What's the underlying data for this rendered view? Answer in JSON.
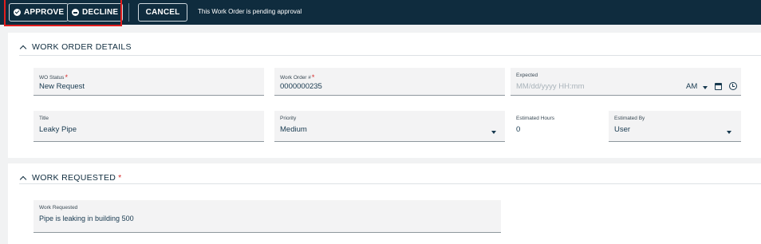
{
  "toolbar": {
    "approve_label": "APPROVE",
    "decline_label": "DECLINE",
    "cancel_label": "CANCEL",
    "status_message": "This Work Order is pending approval"
  },
  "details_section": {
    "title": "WORK ORDER DETAILS",
    "wo_status": {
      "label": "WO Status",
      "value": "New Request"
    },
    "work_order_number": {
      "label": "Work Order #",
      "value": "0000000235"
    },
    "expected": {
      "label": "Expected",
      "placeholder": "MM/dd/yyyy HH:mm",
      "ampm": "AM"
    },
    "title_field": {
      "label": "Title",
      "value": "Leaky Pipe"
    },
    "priority": {
      "label": "Priority",
      "value": "Medium"
    },
    "estimated_hours": {
      "label": "Estimated Hours",
      "value": "0"
    },
    "estimated_by": {
      "label": "Estimated By",
      "value": "User"
    }
  },
  "work_requested_section": {
    "title": "WORK REQUESTED",
    "work_requested": {
      "label": "Work Requested",
      "value": "Pipe is leaking in building 500"
    }
  },
  "colors": {
    "topbar": "#0f2c3e",
    "highlight": "#e21d1d",
    "required": "#d62b2b",
    "text": "#17394f"
  }
}
